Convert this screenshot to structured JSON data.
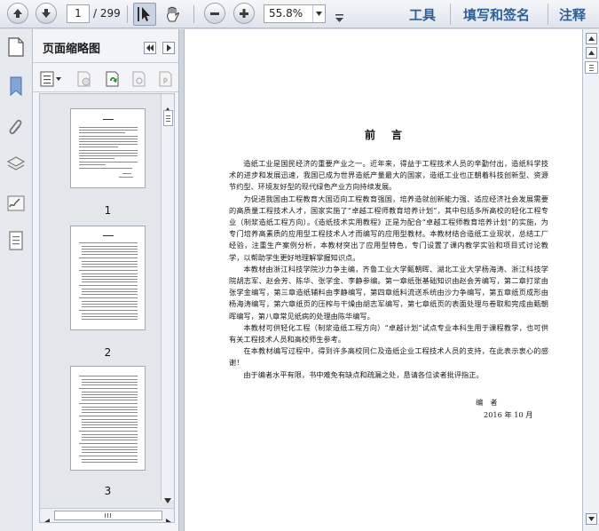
{
  "toolbar": {
    "page_current": "1",
    "page_total": "/ 299",
    "zoom": "55.8%",
    "menu": {
      "tools": "工具",
      "sign": "填写和签名",
      "comment": "注释"
    }
  },
  "panel": {
    "title": "页面缩略图",
    "thumbnails": [
      {
        "label": "1"
      },
      {
        "label": "2"
      },
      {
        "label": "3"
      }
    ]
  },
  "document": {
    "title": "前言",
    "paragraphs": [
      "造纸工业是国民经济的重要产业之一。近年来，得益于工程技术人员的辛勤付出，造纸科学技术的进步和发展迅速，我国已成为世界造纸产量最大的国家，造纸工业也正朝着科技创新型、资源节约型、环境友好型的现代绿色产业方向持续发展。",
      "为促进我国由工程教育大国迈向工程教育强国，培养造就创新能力强、适应经济社会发展需要的高质量工程技术人才，国家实施了“卓越工程师教育培养计划”，其中包括多所高校的轻化工程专业（制浆造纸工程方向）。《造纸技术实用教程》正是为配合“卓越工程师教育培养计划”的实施，为专门培养高素质的应用型工程技术人才而编写的应用型教材。本教材结合造纸工业现状，总结工厂经验，注重生产案例分析，本教材突出了应用型特色，专门设置了课内教学实验和项目式讨论教学，以帮助学生更好地理解掌握知识点。",
      "本教材由浙江科技学院沙力争主编，齐鲁工业大学甄朝晖、湖北工业大学杨海涛、浙江科技学院胡志军、赵会芳、陈华、张学金、李静参编。第一章纸张基础知识由赵会芳编写，第二章打浆由张学金编写，第三章造纸辅料由李静编写，第四章纸料流送系统由沙力争编写，第五章纸页成形由杨海涛编写，第六章纸页的压榨与干燥由胡志军编写，第七章纸页的表面处理与卷取和完成由甄朝晖编写，第八章常见纸病的处理由陈华编写。",
      "本教材可供轻化工程（制浆造纸工程方向）“卓越计划”试点专业本科生用于课程教学，也可供有关工程技术人员和高校师生参考。",
      "在本教材编写过程中，得到许多高校同仁及造纸企业工程技术人员的支持，在此表示衷心的感谢！",
      "由于编者水平有限，书中难免有缺点和疏漏之处，恳请各位读者批评指正。"
    ],
    "signature": "编　者",
    "date": "2016 年 10 月"
  }
}
